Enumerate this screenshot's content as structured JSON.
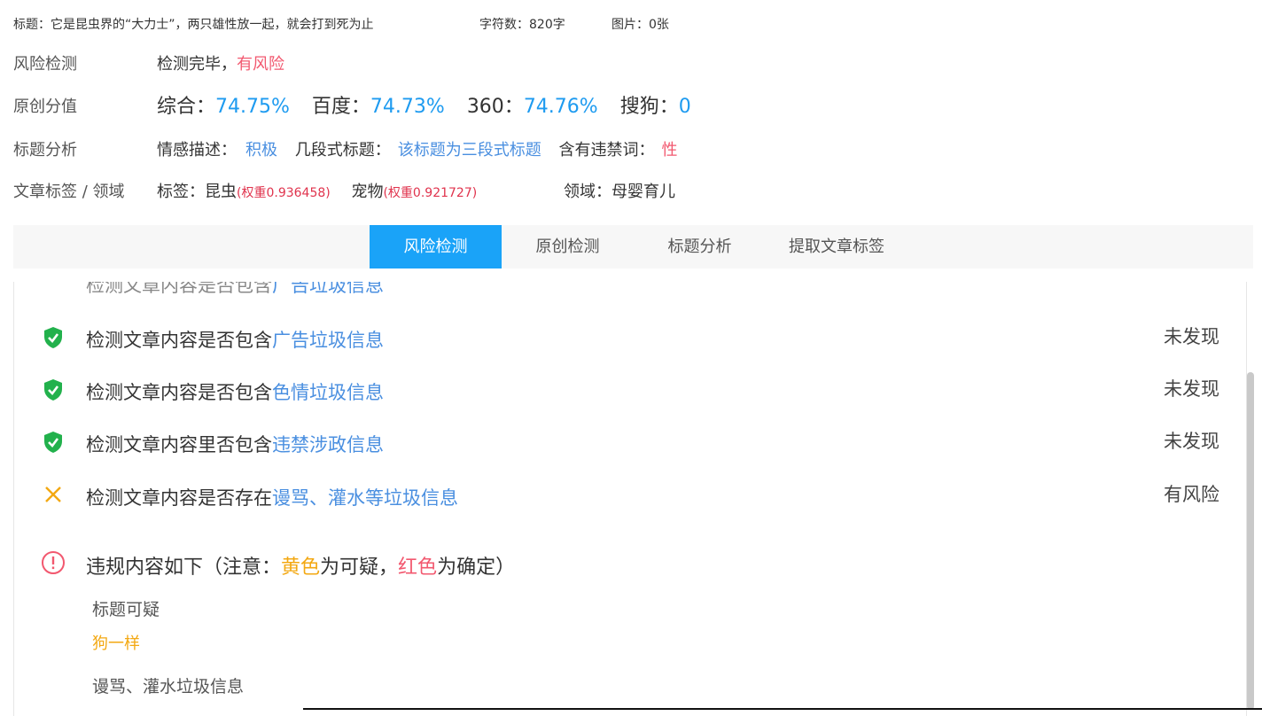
{
  "meta": {
    "title_text": "标题：它是昆虫界的“大力士”，两只雄性放一起，就会打到死为止",
    "word_count": "字符数：820字",
    "images": "图片：0张"
  },
  "risk": {
    "label": "风险检测",
    "prefix": "检测完毕，",
    "result": "有风险"
  },
  "originality": {
    "label": "原创分值",
    "overall_label": "综合：",
    "overall": "74.75%",
    "baidu_label": "百度：",
    "baidu": "74.73%",
    "s360_label": "360：",
    "s360": "74.76%",
    "sogou_label": "搜狗：",
    "sogou": "0"
  },
  "title_analysis": {
    "label": "标题分析",
    "emotion_label": "情感描述：",
    "emotion": "积极",
    "segments_label": "几段式标题：",
    "segments": "该标题为三段式标题",
    "banned_label": "含有违禁词：",
    "banned": "性"
  },
  "tags": {
    "label": "文章标签 / 领域",
    "tag_label": "标签：",
    "tag1": "昆虫",
    "tag1_weight": "(权重0.936458)",
    "tag2": "宠物",
    "tag2_weight": "(权重0.921727)",
    "domain": "领域：母婴育儿"
  },
  "tabs": [
    "风险检测",
    "原创检测",
    "标题分析",
    "提取文章标签"
  ],
  "active_tab": 0,
  "checks": [
    {
      "prefix": "检测文章内容是否包含",
      "highlight": "广告垃圾信息",
      "status": "未发现",
      "icon": "shield-check-icon"
    },
    {
      "prefix": "检测文章内容是否包含",
      "highlight": "色情垃圾信息",
      "status": "未发现",
      "icon": "shield-check-icon"
    },
    {
      "prefix": "检测文章内容里否包含",
      "highlight": "违禁涉政信息",
      "status": "未发现",
      "icon": "shield-check-icon"
    },
    {
      "prefix": "检测文章内容是否存在",
      "highlight": "谩骂、灌水等垃圾信息",
      "status": "有风险",
      "icon": "cross-icon"
    }
  ],
  "violations": {
    "heading_pre": "违规内容如下（注意：",
    "yellow_word": "黄色",
    "heading_mid": "为可疑，",
    "red_word": "红色",
    "heading_post": "为确定）",
    "title_suspicious_label": "标题可疑",
    "title_suspicious_word": "狗一样",
    "abuse_label": "谩骂、灌水垃圾信息"
  },
  "colors": {
    "accent_blue": "#1aa3f8",
    "risk_red": "#f2586f",
    "warning_yellow": "#f3a812",
    "shield_green": "#22b14c"
  }
}
